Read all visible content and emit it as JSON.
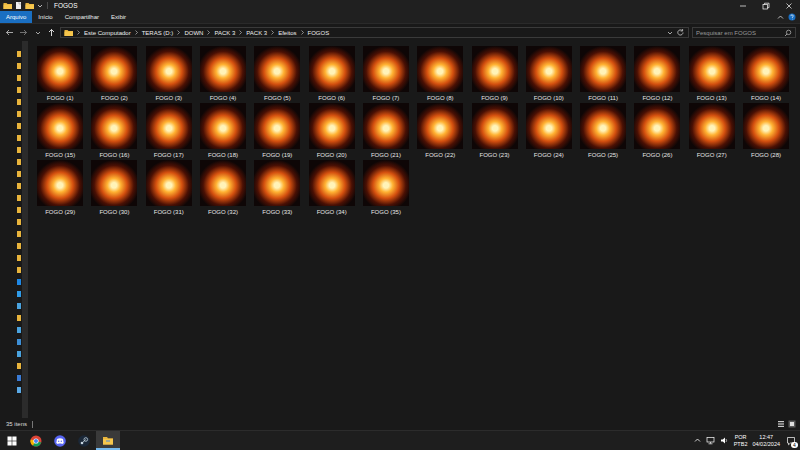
{
  "window": {
    "title": "FOGOS"
  },
  "ribbon": {
    "tabs": [
      {
        "label": "Arquivo",
        "selected": true
      },
      {
        "label": "Início",
        "selected": false
      },
      {
        "label": "Compartilhar",
        "selected": false
      },
      {
        "label": "Exibir",
        "selected": false
      }
    ]
  },
  "address": {
    "breadcrumb": [
      "Este Computador",
      "TERAS (D:)",
      "DOWN",
      "PACK 3",
      "PACK 3",
      "Efeitos",
      "FOGOS"
    ]
  },
  "search": {
    "placeholder": "Pesquisar em FOGOS"
  },
  "files": [
    {
      "name": "FOGO (1)"
    },
    {
      "name": "FOGO (2)"
    },
    {
      "name": "FOGO (3)"
    },
    {
      "name": "FOGO (4)"
    },
    {
      "name": "FOGO (5)"
    },
    {
      "name": "FOGO (6)"
    },
    {
      "name": "FOGO (7)"
    },
    {
      "name": "FOGO (8)"
    },
    {
      "name": "FOGO (9)"
    },
    {
      "name": "FOGO (10)"
    },
    {
      "name": "FOGO (11)"
    },
    {
      "name": "FOGO (12)"
    },
    {
      "name": "FOGO (13)"
    },
    {
      "name": "FOGO (14)"
    },
    {
      "name": "FOGO (15)"
    },
    {
      "name": "FOGO (16)"
    },
    {
      "name": "FOGO (17)"
    },
    {
      "name": "FOGO (18)"
    },
    {
      "name": "FOGO (19)"
    },
    {
      "name": "FOGO (20)"
    },
    {
      "name": "FOGO (21)"
    },
    {
      "name": "FOGO (22)"
    },
    {
      "name": "FOGO (23)"
    },
    {
      "name": "FOGO (24)"
    },
    {
      "name": "FOGO (25)"
    },
    {
      "name": "FOGO (26)"
    },
    {
      "name": "FOGO (27)"
    },
    {
      "name": "FOGO (28)"
    },
    {
      "name": "FOGO (29)"
    },
    {
      "name": "FOGO (30)"
    },
    {
      "name": "FOGO (31)"
    },
    {
      "name": "FOGO (32)"
    },
    {
      "name": "FOGO (33)"
    },
    {
      "name": "FOGO (34)"
    },
    {
      "name": "FOGO (35)"
    }
  ],
  "status_bar": {
    "count": "35 itens"
  },
  "taskbar": {
    "apps": [
      {
        "kind": "chrome",
        "active": false
      },
      {
        "kind": "discord",
        "active": false
      },
      {
        "kind": "steam",
        "active": false
      },
      {
        "kind": "explorer",
        "active": true
      }
    ]
  },
  "tray": {
    "language": "POR",
    "layout": "PTB2",
    "time": "12:47",
    "date": "04/02/2024",
    "notifications": "4"
  }
}
